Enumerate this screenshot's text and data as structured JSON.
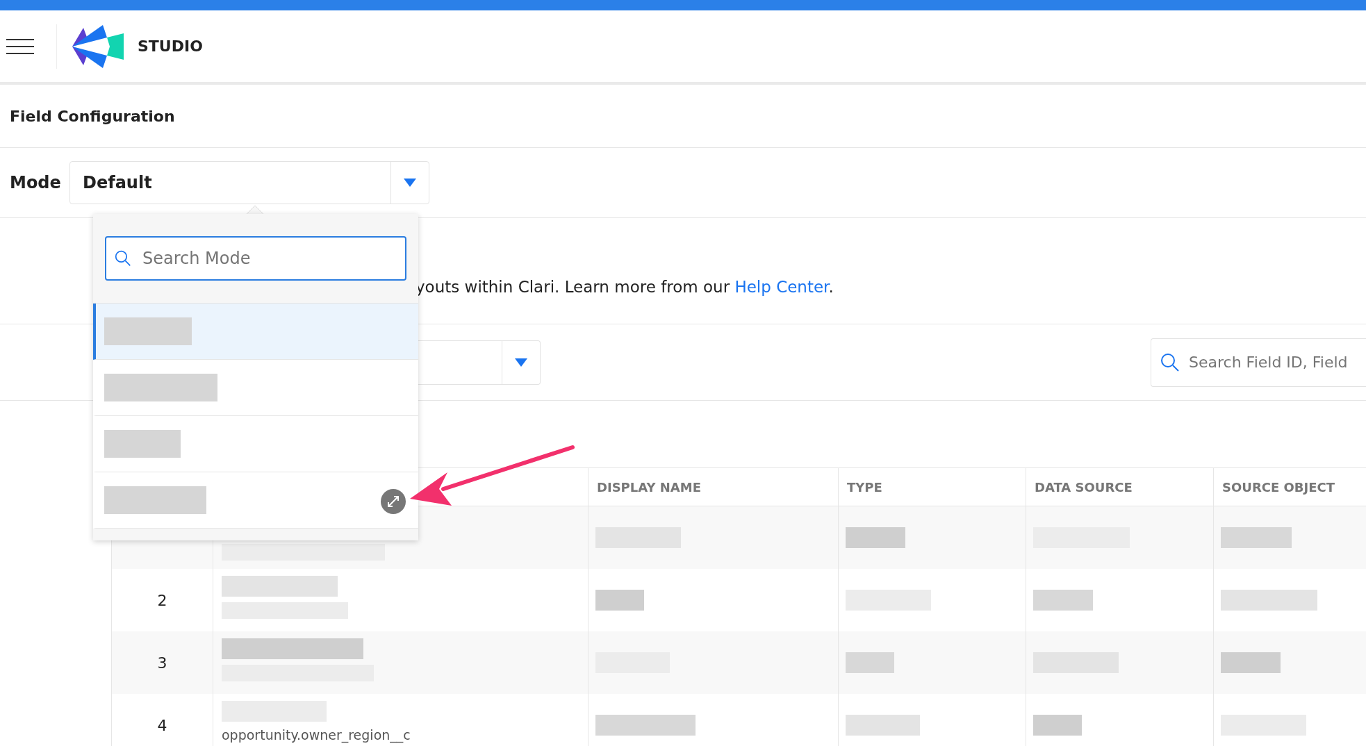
{
  "app": {
    "name": "STUDIO"
  },
  "page_title": "Field Configuration",
  "mode": {
    "label": "Mode",
    "value": "Default"
  },
  "mode_menu": {
    "search_placeholder": "Search Mode",
    "options": [
      {
        "selected": true
      },
      {
        "selected": false
      },
      {
        "selected": false
      },
      {
        "selected": false
      }
    ]
  },
  "description": {
    "text": "youts within Clari. Learn more from our ",
    "link": "Help Center",
    "end": "."
  },
  "filter": {
    "search_placeholder": "Search Field ID, Field"
  },
  "table": {
    "columns": [
      "DISPLAY NAME",
      "TYPE",
      "DATA SOURCE",
      "SOURCE OBJECT"
    ],
    "rows": [
      {},
      {
        "number": "2"
      },
      {
        "number": "3"
      },
      {
        "number": "4",
        "field_id": "opportunity.owner_region__c"
      }
    ]
  }
}
